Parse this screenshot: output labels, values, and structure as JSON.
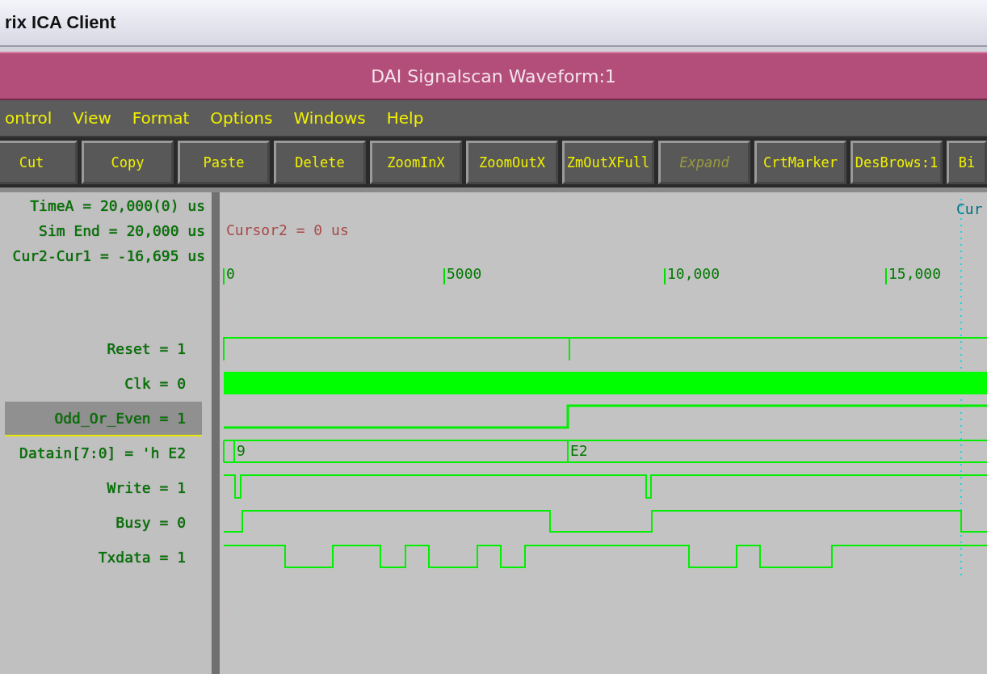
{
  "app_title": "rix ICA Client",
  "window": {
    "title": "DAI Signalscan Waveform:1"
  },
  "menu": [
    "ontrol",
    "View",
    "Format",
    "Options",
    "Windows",
    "Help"
  ],
  "toolbar": [
    {
      "label": "Cut",
      "disabled": false
    },
    {
      "label": "Copy",
      "disabled": false
    },
    {
      "label": "Paste",
      "disabled": false
    },
    {
      "label": "Delete",
      "disabled": false
    },
    {
      "label": "ZoomInX",
      "disabled": false
    },
    {
      "label": "ZoomOutX",
      "disabled": false
    },
    {
      "label": "ZmOutXFull",
      "disabled": false
    },
    {
      "label": "Expand",
      "disabled": true
    },
    {
      "label": "CrtMarker",
      "disabled": false
    },
    {
      "label": "DesBrows:1",
      "disabled": false
    },
    {
      "label": "Bi",
      "disabled": false
    }
  ],
  "readouts": [
    "TimeA = 20,000(0) us",
    "Sim End = 20,000 us",
    "Cur2-Cur1 = -16,695 us"
  ],
  "cursor2": "Cursor2 = 0 us",
  "cursor_label": "Cur",
  "axis_ticks": [
    "0",
    "5000",
    "10,000",
    "15,000"
  ],
  "signals": [
    {
      "label": "Reset = 1",
      "kind": "bit",
      "selected": false
    },
    {
      "label": "Clk = 0",
      "kind": "clock",
      "selected": false
    },
    {
      "label": "Odd_Or_Even = 1",
      "kind": "bit",
      "selected": true
    },
    {
      "label": "Datain[7:0] = 'h E2",
      "kind": "bus",
      "selected": false,
      "bus_values": [
        "9",
        "E2"
      ]
    },
    {
      "label": "Write = 1",
      "kind": "bit",
      "selected": false
    },
    {
      "label": "Busy = 0",
      "kind": "bit",
      "selected": false
    },
    {
      "label": "Txdata = 1",
      "kind": "bit",
      "selected": false
    }
  ]
}
